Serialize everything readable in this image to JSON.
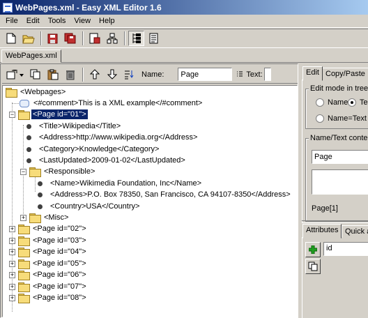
{
  "window": {
    "title": "WebPages.xml - Easy XML Editor 1.6"
  },
  "menu": [
    "File",
    "Edit",
    "Tools",
    "View",
    "Help"
  ],
  "doc_tab": "WebPages.xml",
  "tree_toolbar": {
    "name_label": "Name:",
    "name_value": "Page",
    "text_label": "Text:"
  },
  "tree": [
    {
      "text": "<Webpages>",
      "type": "folder",
      "expander": "",
      "level": 0
    },
    {
      "text": "<#comment>This is a XML example</#comment>",
      "type": "comment",
      "expander": "",
      "level": 1
    },
    {
      "text": "<Page id=\"01\">",
      "type": "folder",
      "expander": "-",
      "level": 1,
      "selected": true
    },
    {
      "text": "<Title>Wikipedia</Title>",
      "type": "leaf",
      "expander": "",
      "level": 2
    },
    {
      "text": "<Address>http://www.wikipedia.org</Address>",
      "type": "leaf",
      "expander": "",
      "level": 2
    },
    {
      "text": "<Category>Knowledge</Category>",
      "type": "leaf",
      "expander": "",
      "level": 2
    },
    {
      "text": "<LastUpdated>2009-01-02</LastUpdated>",
      "type": "leaf",
      "expander": "",
      "level": 2
    },
    {
      "text": "<Responsible>",
      "type": "folder",
      "expander": "-",
      "level": 2
    },
    {
      "text": "<Name>Wikimedia Foundation, Inc</Name>",
      "type": "leaf",
      "expander": "",
      "level": 3
    },
    {
      "text": "<Address>P.O. Box 78350, San Francisco, CA 94107-8350</Address>",
      "type": "leaf",
      "expander": "",
      "level": 3
    },
    {
      "text": "<Country>USA</Country>",
      "type": "leaf",
      "expander": "",
      "level": 3
    },
    {
      "text": "<Misc>",
      "type": "folder",
      "expander": "+",
      "level": 2
    },
    {
      "text": "<Page id=\"02\">",
      "type": "folder",
      "expander": "+",
      "level": 1
    },
    {
      "text": "<Page id=\"03\">",
      "type": "folder",
      "expander": "+",
      "level": 1
    },
    {
      "text": "<Page id=\"04\">",
      "type": "folder",
      "expander": "+",
      "level": 1
    },
    {
      "text": "<Page id=\"05\">",
      "type": "folder",
      "expander": "+",
      "level": 1
    },
    {
      "text": "<Page id=\"06\">",
      "type": "folder",
      "expander": "+",
      "level": 1
    },
    {
      "text": "<Page id=\"07\">",
      "type": "folder",
      "expander": "+",
      "level": 1
    },
    {
      "text": "<Page id=\"08\">",
      "type": "folder",
      "expander": "+",
      "level": 1
    }
  ],
  "right_panel": {
    "tabs": [
      "Edit",
      "Copy/Paste"
    ],
    "edit_mode_title": "Edit mode in tree",
    "radio_name": "Name",
    "radio_text": "Te",
    "radio_name_text": "Name=Text",
    "content_title": "Name/Text conter",
    "name_value": "Page",
    "path": "Page[1]",
    "bottom_tabs": [
      "Attributes",
      "Quick a"
    ],
    "attr_value": "id"
  },
  "colors": {
    "selection": "#0a246a",
    "title_start": "#0a246a",
    "title_end": "#a6caf0"
  }
}
